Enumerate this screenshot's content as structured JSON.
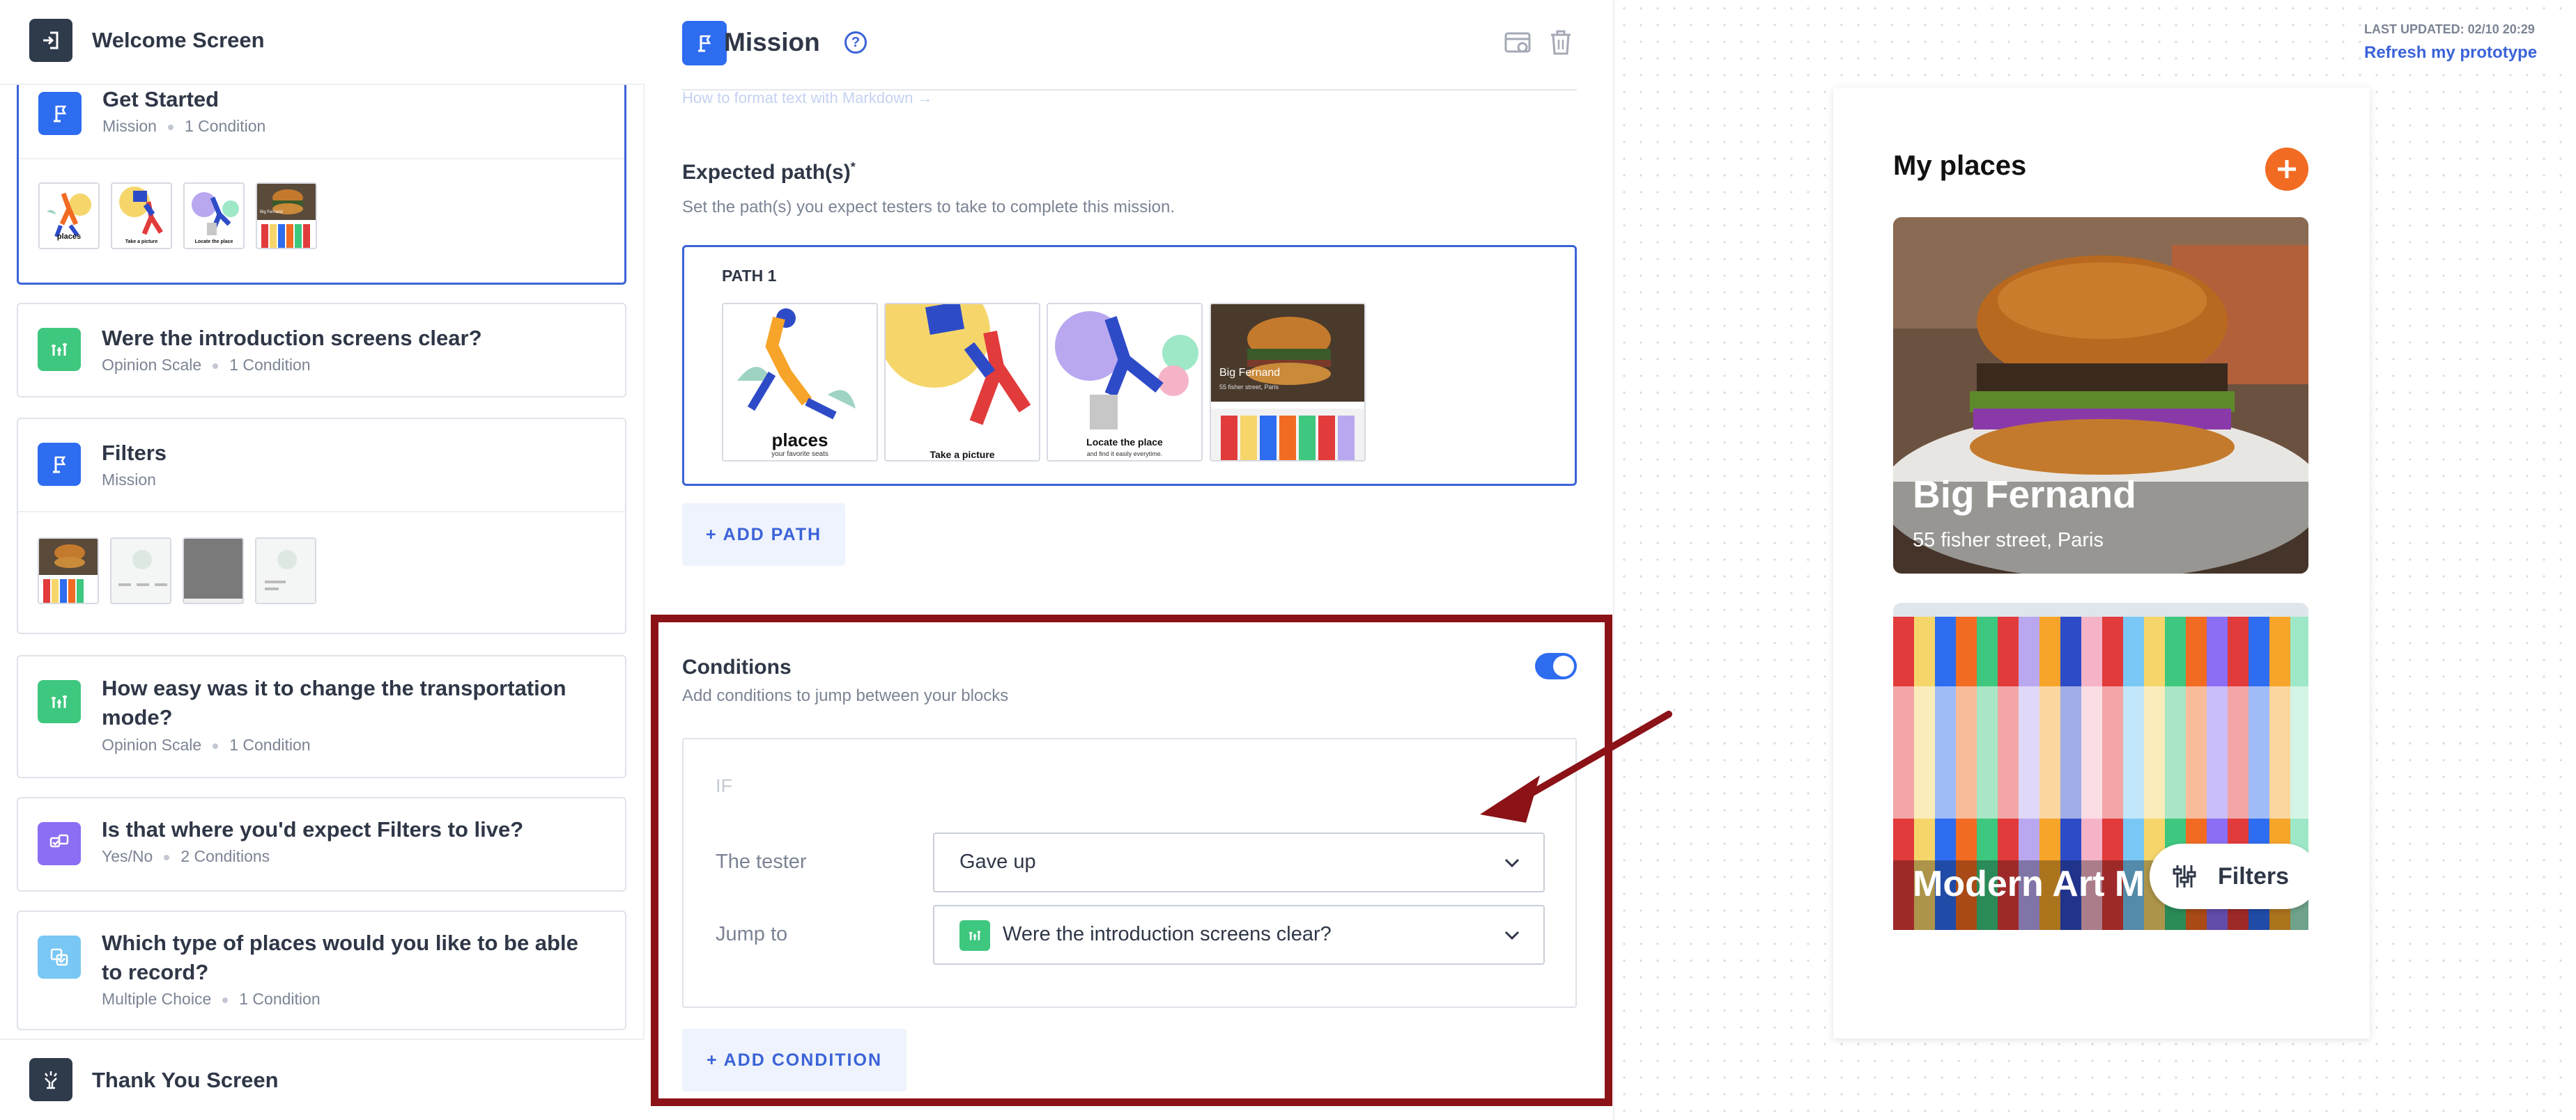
{
  "sidebar": {
    "welcome_label": "Welcome Screen",
    "thankyou_label": "Thank You Screen",
    "blocks": [
      {
        "title": "Get Started",
        "type": "Mission",
        "conditions": "1 Condition",
        "thumbs": [
          "places",
          "Take a picture",
          "Locate the place",
          "Big Fernand"
        ]
      },
      {
        "title": "Were the introduction screens clear?",
        "type": "Opinion Scale",
        "conditions": "1 Condition"
      },
      {
        "title": "Filters",
        "type": "Mission"
      },
      {
        "title": "How easy was it to change the transportation mode?",
        "type": "Opinion Scale",
        "conditions": "1 Condition"
      },
      {
        "title": "Is that where you'd expect Filters to live?",
        "type": "Yes/No",
        "conditions": "2 Conditions"
      },
      {
        "title": "Which type of places would you like to be able to record?",
        "type": "Multiple Choice",
        "conditions": "1 Condition"
      }
    ]
  },
  "editor": {
    "title": "Mission",
    "help_label": "?",
    "markdown_hint": "How to format text with Markdown →",
    "expected_title": "Expected path(s)",
    "expected_required_mark": "*",
    "expected_sub": "Set the path(s) you expect testers to take to complete this mission.",
    "path_label": "PATH 1",
    "path_thumbs": [
      {
        "caption": "places",
        "subcaption": "your favorite seats"
      },
      {
        "caption": "Take a picture",
        "subcaption": ""
      },
      {
        "caption": "Locate the place",
        "subcaption": "and find it easily everytime."
      },
      {
        "caption": "Big Fernand",
        "subcaption": "55 fisher street, Paris"
      }
    ],
    "add_path_label": "+ ADD PATH",
    "conditions_title": "Conditions",
    "conditions_sub": "Add conditions to jump between your blocks",
    "conditions_enabled": true,
    "if_label": "IF",
    "tester_label": "The tester",
    "tester_value": "Gave up",
    "jump_label": "Jump to",
    "jump_value": "Were the introduction screens clear?",
    "add_condition_label": "+ ADD CONDITION"
  },
  "preview": {
    "last_updated": "LAST UPDATED: 02/10 20:29",
    "refresh_label": "Refresh my prototype",
    "app_title": "My places",
    "places": [
      {
        "name": "Big Fernand",
        "address": "55 fisher street, Paris"
      },
      {
        "name": "Modern Art M",
        "address": ""
      }
    ],
    "filters_label": "Filters"
  },
  "colors": {
    "accent": "#3b63d8",
    "mission": "#2e6cf0",
    "opinion": "#3ec77e",
    "yesno": "#8b6ef3",
    "choice": "#79c7f4",
    "highlight_frame": "#8b1217",
    "orange": "#f26b22"
  },
  "icons": [
    "sign-in-icon",
    "flag-icon",
    "opinion-scale-icon",
    "yes-no-icon",
    "multiple-choice-icon",
    "thank-you-icon",
    "preview-icon",
    "trash-icon",
    "chevron-down-icon",
    "plus-icon",
    "filters-icon"
  ]
}
